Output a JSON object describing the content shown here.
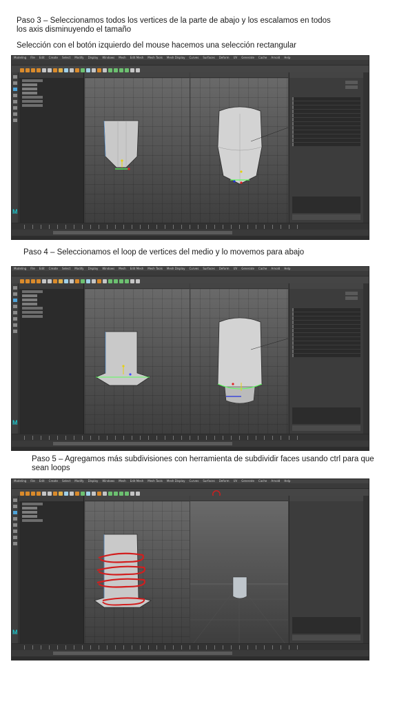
{
  "steps": [
    {
      "title": "Paso 3 – Seleccionamos todos los vertices de la parte de abajo y los escalamos en todos los axis disminuyendo el tamaño",
      "subtitle": "Selección con el botón izquierdo del mouse hacemos una selección rectangular"
    },
    {
      "title": "Paso 4 – Seleccionamos el loop de vertices del medio y lo movemos para abajo",
      "subtitle": ""
    },
    {
      "title": "Paso 5 – Agregamos más subdivisiones con herramienta de subdividir faces usando ctrl para que sean loops",
      "subtitle": ""
    }
  ],
  "app": {
    "menus": [
      "Modeling",
      "File",
      "Edit",
      "Create",
      "Select",
      "Modify",
      "Display",
      "Windows",
      "Mesh",
      "Edit Mesh",
      "Mesh Tools",
      "Mesh Display",
      "Curves",
      "Surfaces",
      "Deform",
      "UV",
      "Generate",
      "Cache",
      "Arnold",
      "Help"
    ],
    "shelf_tab": "Poly Modeling",
    "logo": "M",
    "colors": {
      "ui_bg": "#3c3c3c",
      "viewport_top": "#6b6b6b",
      "viewport_bottom": "#3e3e3e",
      "selection_highlight": "#4fa3d8",
      "red_annotation": "#d21e1e"
    }
  }
}
